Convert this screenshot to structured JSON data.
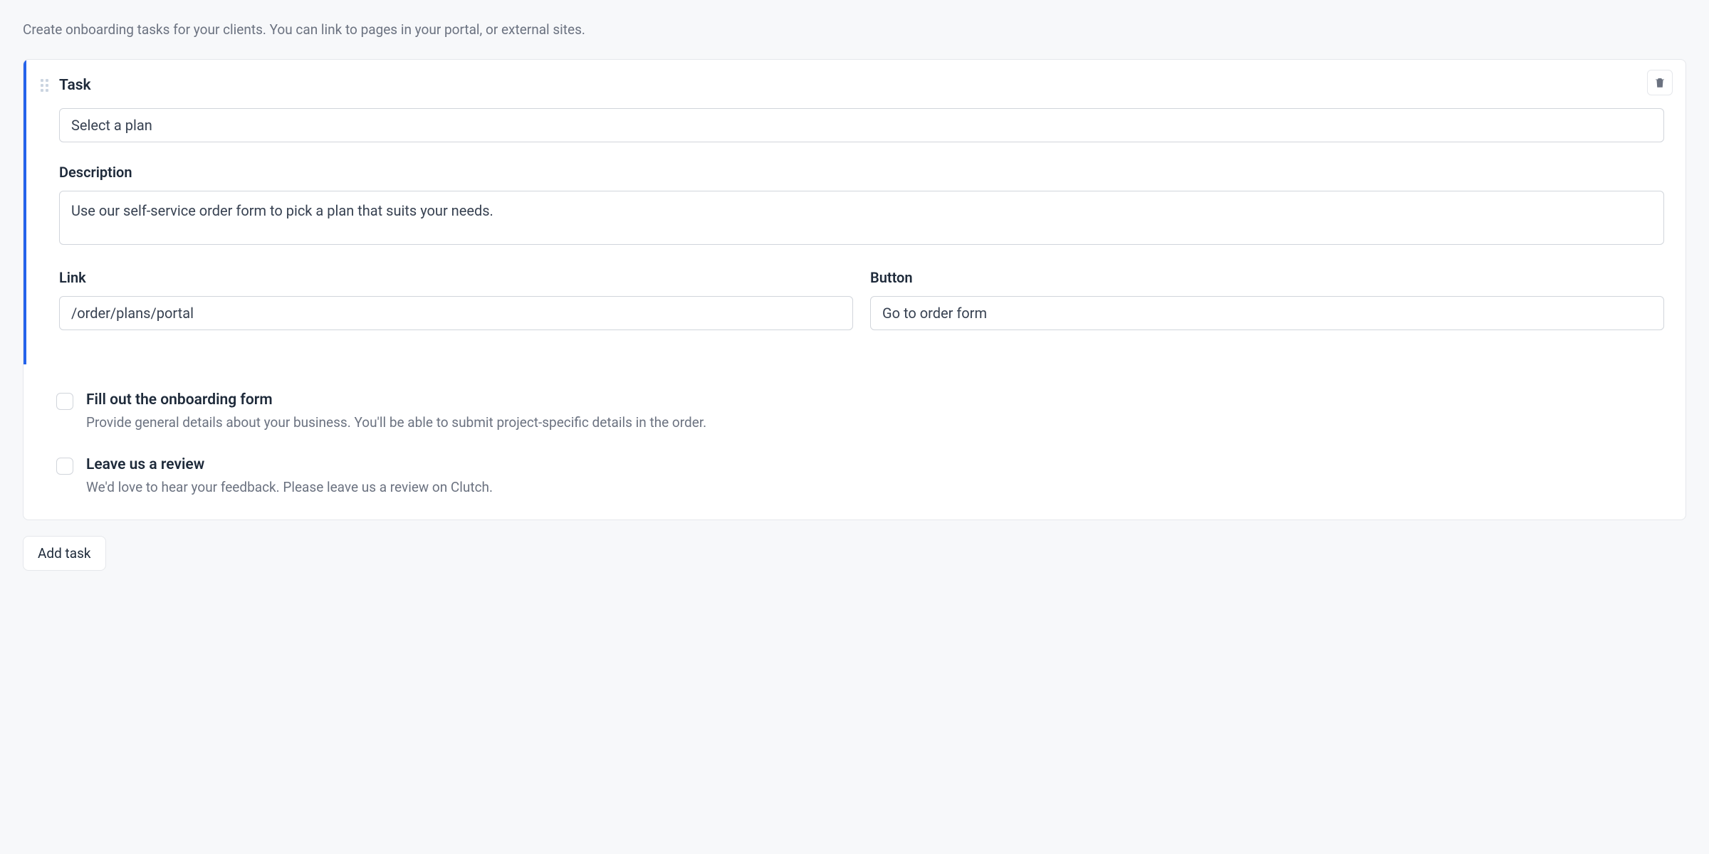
{
  "intro": "Create onboarding tasks for your clients. You can link to pages in your portal, or external sites.",
  "editor": {
    "task_label": "Task",
    "task_value": "Select a plan",
    "description_label": "Description",
    "description_value": "Use our self-service order form to pick a plan that suits your needs.",
    "link_label": "Link",
    "link_value": "/order/plans/portal",
    "button_label": "Button",
    "button_value": "Go to order form"
  },
  "tasks": [
    {
      "title": "Fill out the onboarding form",
      "description": "Provide general details about your business. You'll be able to submit project-specific details in the order."
    },
    {
      "title": "Leave us a review",
      "description": "We'd love to hear your feedback. Please leave us a review on Clutch."
    }
  ],
  "add_task_label": "Add task"
}
